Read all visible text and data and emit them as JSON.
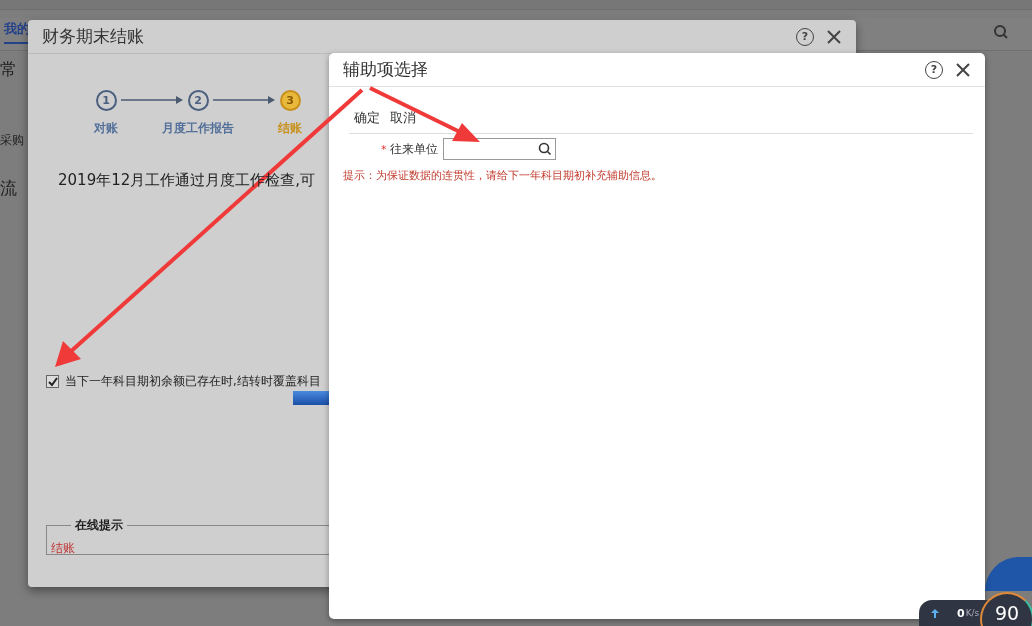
{
  "background": {
    "tab": "我的",
    "side_items": [
      "常",
      "采购",
      "流"
    ]
  },
  "closing_dialog": {
    "title": "财务期末结账",
    "help": "?",
    "steps": [
      {
        "number": "1",
        "label": "对账",
        "selected": false
      },
      {
        "number": "2",
        "label": "月度工作报告",
        "selected": false
      },
      {
        "number": "3",
        "label": "结账",
        "selected": true
      }
    ],
    "message": "2019年12月工作通过月度工作检查,可",
    "option": {
      "label": "当下一年科目期初余额已存在时,结转时覆盖科目",
      "checked": true
    },
    "online_tips": {
      "legend": "在线提示",
      "text": "结账"
    }
  },
  "aux_dialog": {
    "title": "辅助项选择",
    "help": "?",
    "buttons": [
      "确定",
      "取消"
    ],
    "field": {
      "label": "往来单位",
      "required_mark": "*"
    },
    "hint": "提示：为保证数据的连贯性，请给下一年科目期初补充辅助信息。"
  },
  "speed_widget": {
    "speed": "0",
    "unit": "K/s",
    "percent": "90"
  }
}
